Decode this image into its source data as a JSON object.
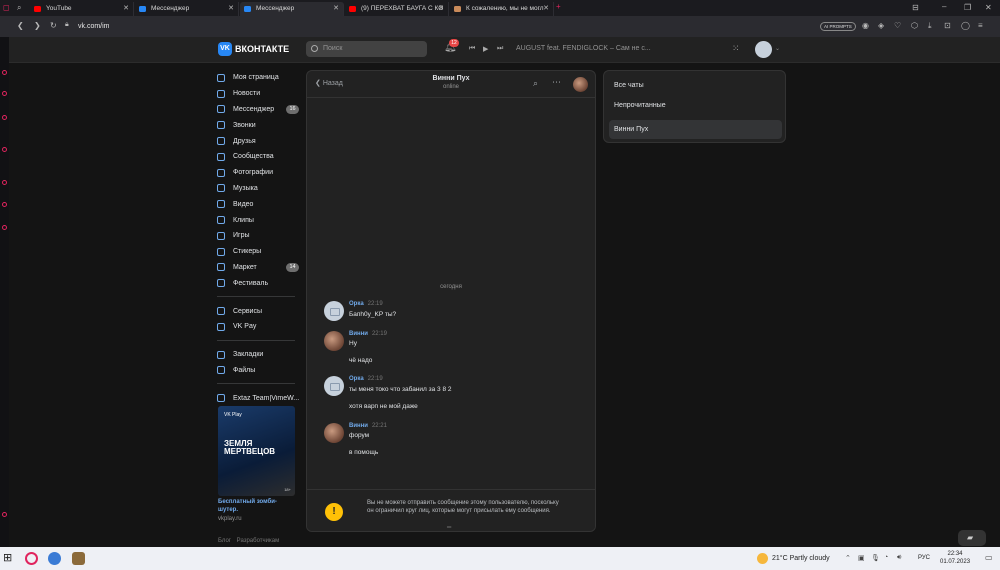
{
  "browser": {
    "tabs": [
      {
        "label": "YouTube",
        "favicon_color": "#ff0000"
      },
      {
        "label": "Мессенджер",
        "favicon_color": "#2787f5"
      },
      {
        "label": "Мессенджер",
        "favicon_color": "#2787f5"
      },
      {
        "label": "(9) ПЕРЕХВАТ БАУГА С КО",
        "favicon_color": "#ff0000"
      },
      {
        "label": "К сожалению, мы не могл",
        "favicon_color": "#c98a5a"
      }
    ],
    "new_tab": "+",
    "url": "vk.com/im",
    "ai_badge": "AI PROMPTS"
  },
  "vk": {
    "logo_text": "ВКОНТАКТЕ",
    "logo_mark": "VK",
    "search_placeholder": "Поиск",
    "notifications_badge": "12",
    "player_track": "AUGUST feat. FENDIGLOCK – Сам не с...",
    "nav": [
      {
        "label": "Моя страница",
        "badge": ""
      },
      {
        "label": "Новости",
        "badge": ""
      },
      {
        "label": "Мессенджер",
        "badge": "16"
      },
      {
        "label": "Звонки",
        "badge": ""
      },
      {
        "label": "Друзья",
        "badge": ""
      },
      {
        "label": "Сообщества",
        "badge": ""
      },
      {
        "label": "Фотографии",
        "badge": ""
      },
      {
        "label": "Музыка",
        "badge": ""
      },
      {
        "label": "Видео",
        "badge": ""
      },
      {
        "label": "Клипы",
        "badge": ""
      },
      {
        "label": "Игры",
        "badge": ""
      },
      {
        "label": "Стикеры",
        "badge": ""
      },
      {
        "label": "Маркет",
        "badge": "14"
      },
      {
        "label": "Фестиваль",
        "badge": ""
      }
    ],
    "nav2": [
      {
        "label": "Сервисы"
      },
      {
        "label": "VK Pay"
      }
    ],
    "nav3": [
      {
        "label": "Закладки"
      },
      {
        "label": "Файлы"
      }
    ],
    "nav4": [
      {
        "label": "Extaz Team|VimeW..."
      }
    ],
    "ad": {
      "brand": "VK Play",
      "title": "ЗЕМЛЯ МЕРТВЕЦОВ",
      "tag": "18+",
      "caption": "Бесплатный зомби-шутер.",
      "domain": "vkplay.ru"
    },
    "footer": {
      "blog": "Блог",
      "dev": "Разработчикам"
    }
  },
  "chat": {
    "back_label": "Назад",
    "peer_name": "Винни Пух",
    "peer_status": "online",
    "date_separator": "сегодня",
    "messages": [
      {
        "author": "Oрка",
        "time": "22:19",
        "lines": [
          "Бапh0у_KP ты?"
        ]
      },
      {
        "author": "Винни",
        "time": "22:19",
        "lines": [
          "Ну",
          "чё надо"
        ]
      },
      {
        "author": "Oрка",
        "time": "22:19",
        "lines": [
          "ты меня токо что забанил за 3 8 2",
          "хотя варп не мой даже"
        ]
      },
      {
        "author": "Винни",
        "time": "22:21",
        "lines": [
          "форум",
          "в помощь"
        ]
      }
    ],
    "notice": "Вы не можете отправить сообщение этому пользователю, поскольку он ограничил круг лиц, которые могут присылать ему сообщения.",
    "notice_icon": "!"
  },
  "folders": [
    {
      "label": "Все чаты"
    },
    {
      "label": "Непрочитанные"
    },
    {
      "label": "Винни Пух"
    }
  ],
  "taskbar": {
    "weather": "21°C  Partly cloudy",
    "lang": "РУС",
    "time": "22:34",
    "date": "01.07.2023"
  }
}
